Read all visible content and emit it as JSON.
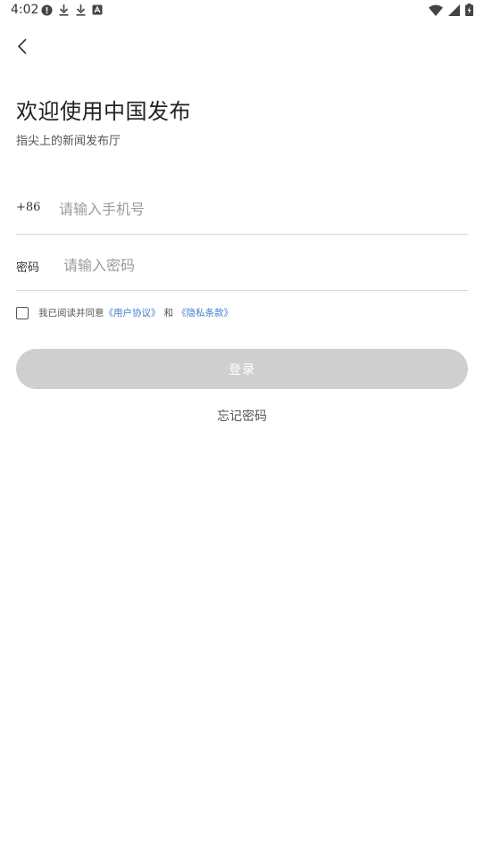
{
  "status_bar": {
    "time": "4:02",
    "left_icons": [
      "alert-circle-icon",
      "download-icon",
      "download-icon",
      "app-notification-icon"
    ],
    "right_icons": [
      "wifi-icon",
      "signal-icon",
      "battery-charging-icon"
    ]
  },
  "header": {
    "back_icon": "chevron-left-icon",
    "title": "欢迎使用中国发布",
    "subtitle": "指尖上的新闻发布厅"
  },
  "form": {
    "phone_prefix": "+86",
    "phone_placeholder": "请输入手机号",
    "password_label": "密码",
    "password_placeholder": "请输入密码"
  },
  "agreement": {
    "checked": false,
    "text": "我已阅读并同意",
    "user_agreement": "《用户协议》",
    "and": "和",
    "privacy_policy": "《隐私条款》"
  },
  "actions": {
    "login_label": "登录",
    "forgot_password": "忘记密码"
  },
  "colors": {
    "link": "#3f7fc9",
    "button_disabled": "#cfcfcf",
    "divider": "#d6d6d6"
  }
}
